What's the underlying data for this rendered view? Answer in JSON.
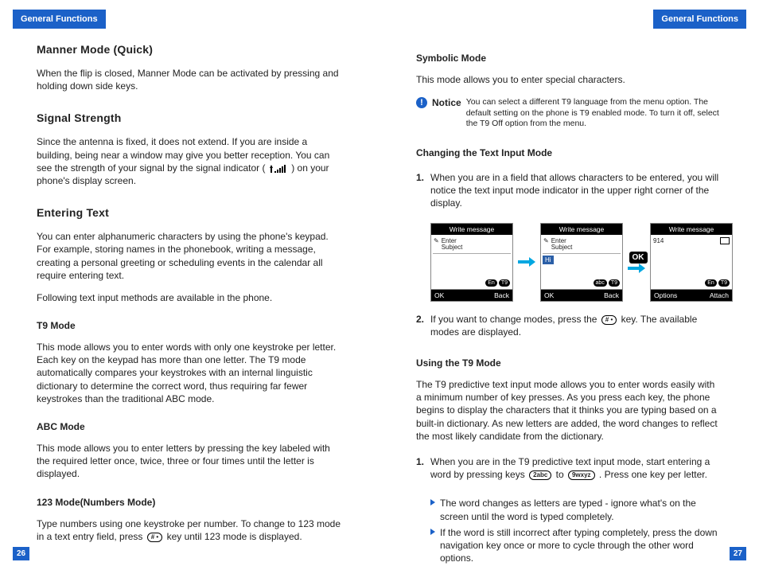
{
  "header": {
    "left": "General Functions",
    "right": "General Functions"
  },
  "left": {
    "h1_manner": "Manner Mode (Quick)",
    "p_manner": "When the flip is closed, Manner Mode can be activated by pressing and holding down side keys.",
    "h1_signal": "Signal Strength",
    "p_signal_a": "Since the antenna is fixed, it does not extend. If you are inside a building, being near a window may give you better reception. You can see the strength of your signal by the signal indicator (",
    "p_signal_b": ") on your phone's display screen.",
    "h1_enter": "Entering Text",
    "p_enter1": "You can enter alphanumeric characters by using the phone's keypad. For example, storing names in the phonebook, writing a message, creating a personal greeting or scheduling events in the calendar all require entering text.",
    "p_enter2": "Following text input methods are available in the phone.",
    "h2_t9": "T9 Mode",
    "p_t9": "This mode allows you to enter words with only one keystroke per letter. Each key on the keypad has more than one letter. The T9 mode automatically compares your keystrokes with an internal linguistic dictionary to determine the correct word, thus requiring far fewer keystrokes than the traditional ABC mode.",
    "h2_abc": "ABC Mode",
    "p_abc": "This mode allows you to enter letters by pressing the key labeled with the required letter once, twice, three or four times until the letter is displayed.",
    "h2_123": "123 Mode(Numbers Mode)",
    "p_123_a": "Type numbers using one keystroke per number. To change to 123 mode in a text entry field, press ",
    "p_123_b": " key until 123 mode is displayed.",
    "key_hash": "# •",
    "page": "26"
  },
  "right": {
    "h2_sym": "Symbolic Mode",
    "p_sym": "This mode allows you to enter special characters.",
    "notice_label": "Notice",
    "notice_icon": "!",
    "notice_text": "You can select a different T9 language from the menu option. The default setting on the phone is T9 enabled mode. To turn it off, select the T9 Off option from the menu.",
    "h2_change": "Changing the Text Input Mode",
    "li1_change": "When you are in a field that allows characters to be entered, you will notice the text input mode indicator in the upper right corner of the display.",
    "phones": {
      "title": "Write message",
      "subj_glyph": "✎",
      "subj": "Enter\nSubject",
      "typed": "Hi",
      "corner": "914",
      "ind_en": "En",
      "ind_t9": "T9",
      "ind_abc": "abc",
      "sk_ok": "OK",
      "sk_back": "Back",
      "sk_options": "Options",
      "sk_attach": "Attach",
      "ok_badge": "OK"
    },
    "li2_change_a": "If you want to change modes, press the ",
    "li2_change_b": " key. The available modes are displayed.",
    "key_hash": "# •",
    "h2_using": "Using the T9 Mode",
    "p_using": "The T9 predictive text input mode allows you to enter words easily with a minimum number of key presses. As you press each key, the phone begins to display the characters that it thinks you are typing based on a built-in dictionary. As new letters are added, the word changes to reflect the most likely candidate from the dictionary.",
    "li1_using_a": "When you are in the T9 predictive text input mode, start entering a word by pressing keys ",
    "li1_using_b": " to ",
    "li1_using_c": " . Press one key per letter.",
    "key_2": "2abc",
    "key_9": "9wxyz",
    "bullet1": "The word changes as letters are typed - ignore what's on the screen until the word is typed completely.",
    "bullet2": "If the word is still incorrect after typing completely, press the down navigation key once or more to cycle through the other word options.",
    "page": "27",
    "num1": "1.",
    "num2": "2."
  }
}
